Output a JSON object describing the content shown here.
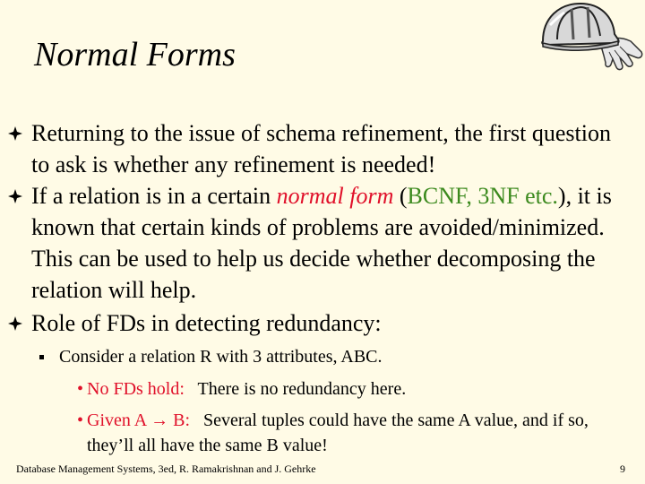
{
  "slide": {
    "title": "Normal Forms",
    "bullets": [
      {
        "text": "Returning to the issue of schema refinement, the first question to ask is whether any refinement is needed!"
      },
      {
        "pre": "If a relation is in a certain ",
        "em": "normal form",
        "mid": " (",
        "green": "BCNF, 3NF etc.",
        "post": "), it is known that certain kinds of problems are avoided/minimized.  This can be used to help us decide whether decomposing the relation will help."
      },
      {
        "text": "Role of FDs in detecting redundancy:"
      }
    ],
    "sub_bullet": "Consider a relation R with 3 attributes, ABC.",
    "sub_sub": [
      {
        "label": "No FDs hold:",
        "text": "   There is no redundancy here."
      },
      {
        "label": "Given A → B:",
        "text": "   Several tuples could have the same A value, and if so, they’ll all have the same B value!"
      }
    ],
    "footer": "Database Management Systems, 3ed,  R. Ramakrishnan and J. Gehrke",
    "page_number": "9"
  },
  "colors": {
    "background": "#fffbe6",
    "red": "#e0102a",
    "green": "#3c8a1e"
  },
  "icons": [
    "hardhat-gloves-clipart",
    "diamond-bullet-icon",
    "square-bullet-icon"
  ]
}
